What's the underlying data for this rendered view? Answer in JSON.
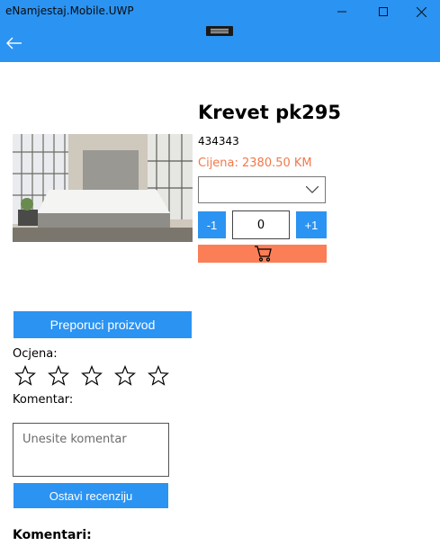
{
  "window": {
    "title": "eNamjestaj.Mobile.UWP"
  },
  "colors": {
    "accent": "#2b93f2",
    "price": "#f2784b",
    "cart": "#fb7e56"
  },
  "product": {
    "title": "Krevet pk295",
    "code": "434343",
    "price": "Cijena: 2380.50 KM",
    "dropdown_value": "",
    "minus_label": "-1",
    "quantity": "0",
    "plus_label": "+1"
  },
  "review": {
    "recommend_button": "Preporuci proizvod",
    "rating_label": "Ocjena:",
    "stars_total": 5,
    "stars_selected": 0,
    "comment_label": "Komentar:",
    "comment_placeholder": "Unesite komentar",
    "submit_button": "Ostavi recenziju",
    "comments_heading": "Komentari:"
  }
}
